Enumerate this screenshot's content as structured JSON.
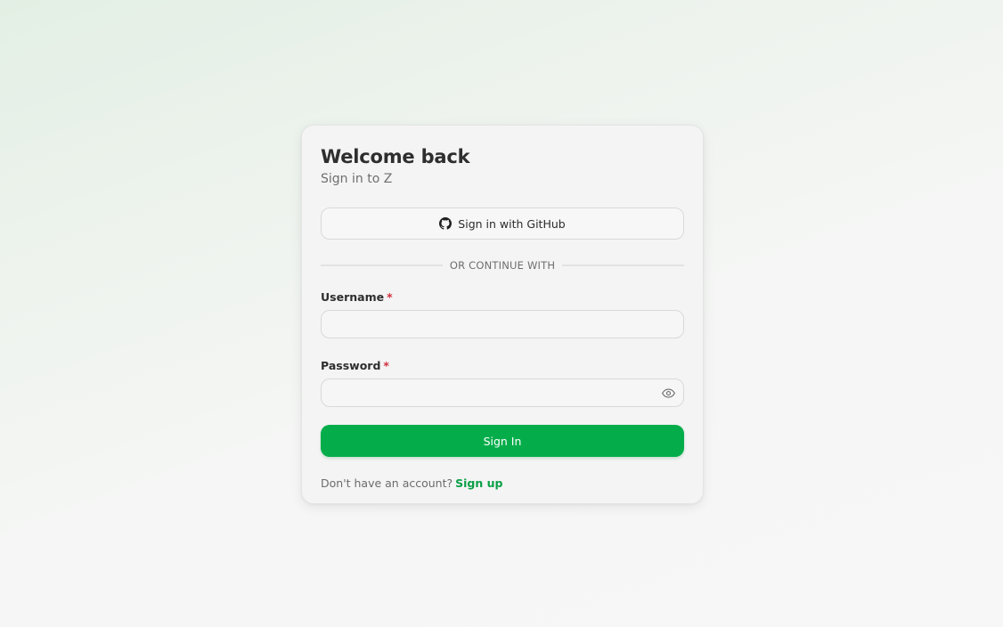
{
  "card": {
    "title": "Welcome back",
    "subtitle": "Sign in to Z"
  },
  "github": {
    "label": "Sign in with GitHub",
    "icon": "github-icon"
  },
  "divider": {
    "text": "OR CONTINUE WITH"
  },
  "form": {
    "username": {
      "label": "Username",
      "required_marker": "*",
      "value": ""
    },
    "password": {
      "label": "Password",
      "required_marker": "*",
      "value": "",
      "toggle_icon": "eye-icon"
    },
    "submit_label": "Sign In"
  },
  "footer": {
    "prompt": "Don't have an account?",
    "link_label": "Sign up"
  },
  "colors": {
    "accent": "#04ad4a",
    "link": "#0a9f47",
    "required": "#d0303f"
  }
}
